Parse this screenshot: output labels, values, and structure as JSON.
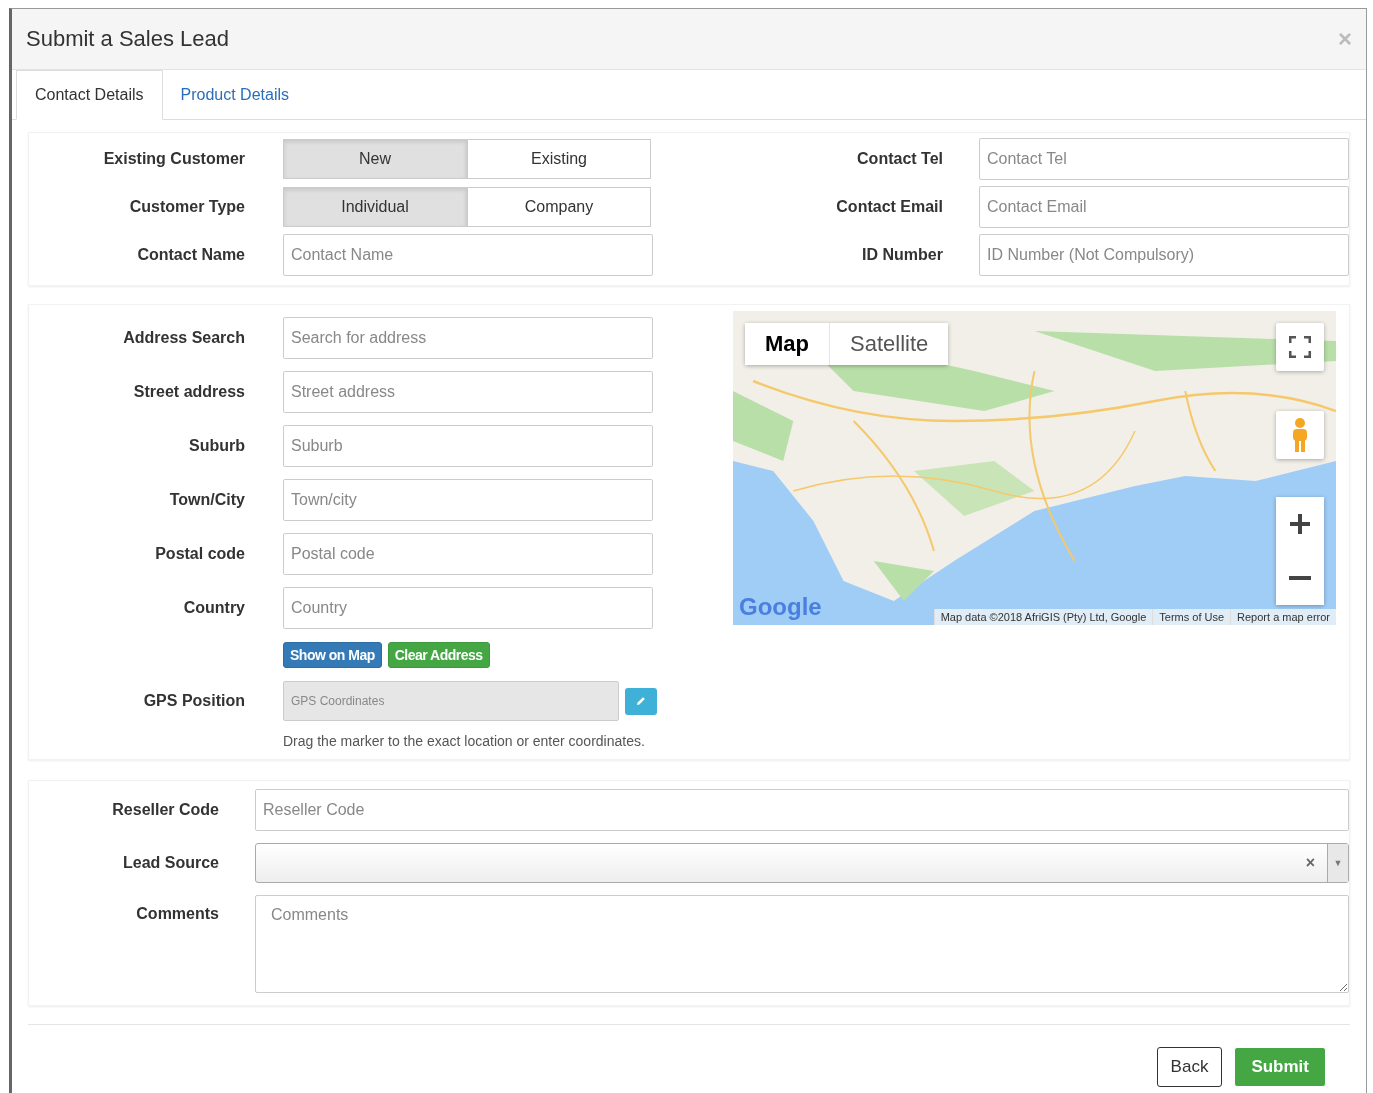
{
  "dialog": {
    "title": "Submit a Sales Lead",
    "close": "×"
  },
  "tabs": [
    {
      "label": "Contact Details",
      "selected": true
    },
    {
      "label": "Product Details",
      "selected": false
    }
  ],
  "contact_left": [
    {
      "label": "Existing Customer",
      "kind": "toggle",
      "options": [
        {
          "label": "New",
          "selected": true
        },
        {
          "label": "Existing",
          "selected": false
        }
      ]
    },
    {
      "label": "Customer Type",
      "kind": "toggle",
      "options": [
        {
          "label": "Individual",
          "selected": true
        },
        {
          "label": "Company",
          "selected": false
        }
      ]
    },
    {
      "label": "Contact Name",
      "kind": "input",
      "placeholder": "Contact Name"
    }
  ],
  "contact_right": [
    {
      "label": "Contact Tel",
      "kind": "input",
      "placeholder": "Contact Tel"
    },
    {
      "label": "Contact Email",
      "kind": "input",
      "placeholder": "Contact Email"
    },
    {
      "label": "ID Number",
      "kind": "input",
      "placeholder": "ID Number (Not Compulsory)"
    }
  ],
  "address_fields": [
    {
      "label": "Address Search",
      "placeholder": "Search for address"
    },
    {
      "label": "Street address",
      "placeholder": "Street address"
    },
    {
      "label": "Suburb",
      "placeholder": "Suburb"
    },
    {
      "label": "Town/City",
      "placeholder": "Town/city"
    },
    {
      "label": "Postal code",
      "placeholder": "Postal code"
    },
    {
      "label": "Country",
      "placeholder": "Country"
    }
  ],
  "address_buttons": [
    {
      "label": "Show on Map",
      "kind": "primary"
    },
    {
      "label": "Clear Address",
      "kind": "success"
    }
  ],
  "gps": {
    "label": "GPS Position",
    "placeholder": "GPS Coordinates",
    "help": "Drag the marker to the exact location or enter coordinates."
  },
  "map": {
    "types": [
      {
        "label": "Map",
        "selected": true
      },
      {
        "label": "Satellite",
        "selected": false
      }
    ],
    "logo": "Google",
    "attribution": [
      "Map data ©2018 AfriGIS (Pty) Ltd, Google",
      "Terms of Use",
      "Report a map error"
    ]
  },
  "reseller": {
    "label": "Reseller Code",
    "placeholder": "Reseller Code"
  },
  "lead_source": {
    "label": "Lead Source",
    "clear": "×",
    "caret": "▼"
  },
  "comments": {
    "label": "Comments",
    "placeholder": "Comments"
  },
  "footer_buttons": [
    {
      "label": "Back",
      "kind": "default"
    },
    {
      "label": "Submit",
      "kind": "success"
    }
  ]
}
